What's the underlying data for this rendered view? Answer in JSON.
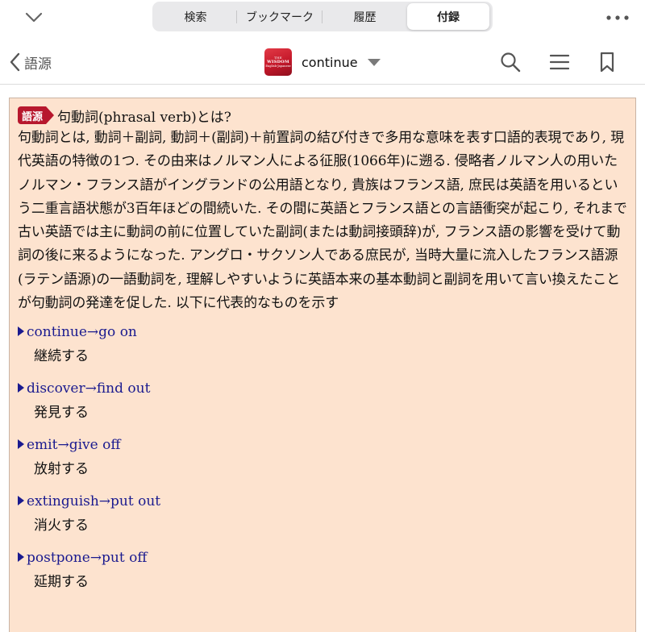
{
  "top_tabs": {
    "items": [
      {
        "label": "検索"
      },
      {
        "label": "ブックマーク"
      },
      {
        "label": "履歴"
      },
      {
        "label": "付録"
      }
    ],
    "active_index": 3
  },
  "navbar": {
    "back_label": "語源",
    "logo": {
      "line1": "THE",
      "line2": "WISDOM",
      "line3": "English-Japanese"
    },
    "title": "continue"
  },
  "article": {
    "tag": "語源",
    "heading": "句動詞(phrasal verb)とは?",
    "body": "句動詞とは, 動詞＋副詞, 動詞＋(副詞)＋前置詞の結び付きで多用な意味を表す口語的表現であり, 現代英語の特徴の1つ. その由来はノルマン人による征服(1066年)に遡る. 侵略者ノルマン人の用いたノルマン・フランス語がイングランドの公用語となり, 貴族はフランス語, 庶民は英語を用いるという二重言語状態が3百年ほどの間続いた. その間に英語とフランス語との言語衝突が起こり, それまで古い英語では主に動詞の前に位置していた副詞(または動詞接頭辞)が, フランス語の影響を受けて動詞の後に来るようになった. アングロ・サクソン人である庶民が, 当時大量に流入したフランス語源(ラテン語源)の一語動詞を, 理解しやすいように英語本来の基本動詞と副詞を用いて言い換えたことが句動詞の発達を促した. 以下に代表的なものを示す",
    "entries": [
      {
        "term": "continue→go on",
        "meaning": "継続する"
      },
      {
        "term": "discover→find out",
        "meaning": "発見する"
      },
      {
        "term": "emit→give off",
        "meaning": "放射する"
      },
      {
        "term": "extinguish→put out",
        "meaning": "消火する"
      },
      {
        "term": "postpone→put off",
        "meaning": "延期する"
      }
    ]
  },
  "icons": {
    "collapse": "chevron-down-icon",
    "more": "more-icon",
    "back": "chevron-left-icon",
    "search": "search-icon",
    "menu": "menu-icon",
    "bookmark": "bookmark-icon"
  },
  "colors": {
    "content_background": "#fde3cf",
    "tag_red": "#b7172d",
    "link_blue": "#1a1a8f"
  }
}
